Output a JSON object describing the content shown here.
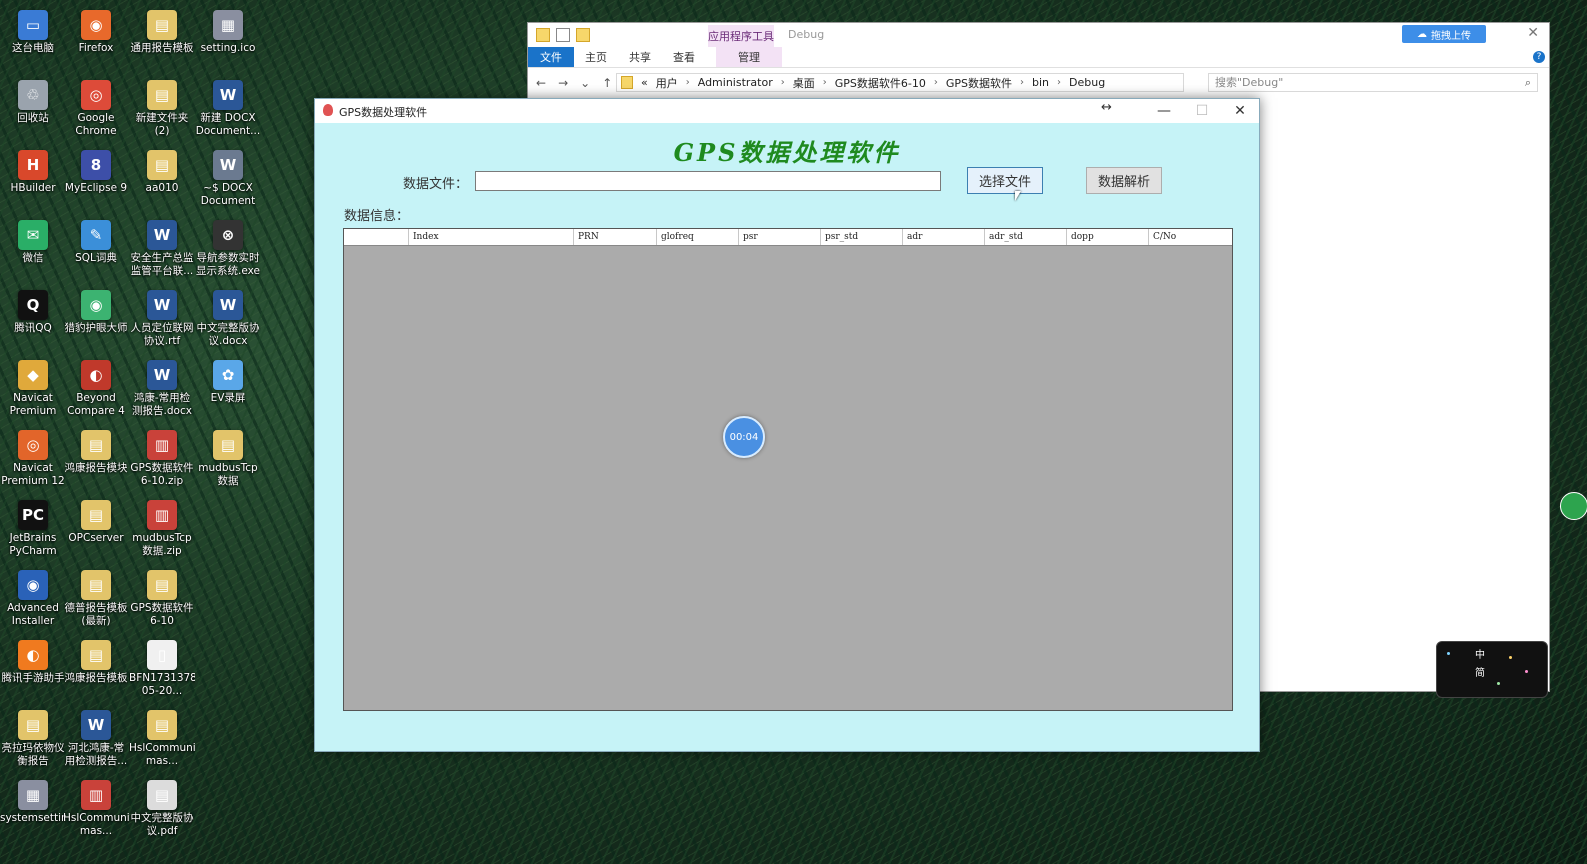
{
  "desktop": {
    "icons": [
      {
        "label": "这台电脑",
        "glyph": "▭",
        "color": "#3a7bd5"
      },
      {
        "label": "Firefox",
        "glyph": "◉",
        "color": "#e8692b"
      },
      {
        "label": "通用报告模板",
        "glyph": "▤",
        "color": "#e2c46a"
      },
      {
        "label": "setting.ico",
        "glyph": "▦",
        "color": "#8a8fa0"
      },
      {
        "label": "回收站",
        "glyph": "♲",
        "color": "#9aa3ad"
      },
      {
        "label": "Google Chrome",
        "glyph": "◎",
        "color": "#dd4b39"
      },
      {
        "label": "新建文件夹 (2)",
        "glyph": "▤",
        "color": "#e2c46a"
      },
      {
        "label": "新建 DOCX Document...",
        "glyph": "W",
        "color": "#2b5797"
      },
      {
        "label": "HBuilder",
        "glyph": "H",
        "color": "#d9482b"
      },
      {
        "label": "MyEclipse 9",
        "glyph": "8",
        "color": "#3d4fa8"
      },
      {
        "label": "aa010",
        "glyph": "▤",
        "color": "#e2c46a"
      },
      {
        "label": "~$ DOCX Document (2...",
        "glyph": "W",
        "color": "#6b7a90"
      },
      {
        "label": "微信",
        "glyph": "✉",
        "color": "#2aae67"
      },
      {
        "label": "SQL词典",
        "glyph": "✎",
        "color": "#3b8fd9"
      },
      {
        "label": "安全生产总监 监管平台联...",
        "glyph": "W",
        "color": "#2b5797"
      },
      {
        "label": "导航参数实时 显示系统.exe",
        "glyph": "⊗",
        "color": "#333333"
      },
      {
        "label": "腾讯QQ",
        "glyph": "Q",
        "color": "#111111"
      },
      {
        "label": "猎豹护眼大师",
        "glyph": "◉",
        "color": "#3cb371"
      },
      {
        "label": "人员定位联网 协议.rtf",
        "glyph": "W",
        "color": "#2b5797"
      },
      {
        "label": "中文完整版协 议.docx",
        "glyph": "W",
        "color": "#2b5797"
      },
      {
        "label": "Navicat Premium",
        "glyph": "◆",
        "color": "#e0a93b"
      },
      {
        "label": "Beyond Compare 4",
        "glyph": "◐",
        "color": "#c0392b"
      },
      {
        "label": "鸿康-常用检 测报告.docx",
        "glyph": "W",
        "color": "#2b5797"
      },
      {
        "label": "EV录屏",
        "glyph": "✿",
        "color": "#5aa7e8"
      },
      {
        "label": "Navicat Premium 12",
        "glyph": "◎",
        "color": "#e2652a"
      },
      {
        "label": "鸿康报告模块",
        "glyph": "▤",
        "color": "#e2c46a"
      },
      {
        "label": "GPS数据软件 6-10.zip",
        "glyph": "▥",
        "color": "#c9423a"
      },
      {
        "label": "mudbusTcp 数据",
        "glyph": "▤",
        "color": "#e2c46a"
      },
      {
        "label": "JetBrains PyCharm Co...",
        "glyph": "PC",
        "color": "#111111"
      },
      {
        "label": "OPCserver",
        "glyph": "▤",
        "color": "#e2c46a"
      },
      {
        "label": "mudbusTcp 数据.zip",
        "glyph": "▥",
        "color": "#c9423a"
      },
      {
        "label": "",
        "glyph": "",
        "color": "transparent"
      },
      {
        "label": "Advanced Installer 15.3",
        "glyph": "◉",
        "color": "#2a62b8"
      },
      {
        "label": "德普报告模板 (最新)",
        "glyph": "▤",
        "color": "#e2c46a"
      },
      {
        "label": "GPS数据软件 6-10",
        "glyph": "▤",
        "color": "#e2c46a"
      },
      {
        "label": "",
        "glyph": "",
        "color": "transparent"
      },
      {
        "label": "腾讯手游助手",
        "glyph": "◐",
        "color": "#f07a1f"
      },
      {
        "label": "鸿康报告模板",
        "glyph": "▤",
        "color": "#e2c46a"
      },
      {
        "label": "BFN17313785_11-05-20...",
        "glyph": "▯",
        "color": "#f0f0f0"
      },
      {
        "label": "",
        "glyph": "",
        "color": "transparent"
      },
      {
        "label": "亮拉玛依物仪 衡报告",
        "glyph": "▤",
        "color": "#e2c46a"
      },
      {
        "label": "河北鸿康-常 用检测报告...",
        "glyph": "W",
        "color": "#2b5797"
      },
      {
        "label": "HslCommunication-mas...",
        "glyph": "▤",
        "color": "#e2c46a"
      },
      {
        "label": "",
        "glyph": "",
        "color": "transparent"
      },
      {
        "label": "systemsetting.png",
        "glyph": "▦",
        "color": "#8a8fa0"
      },
      {
        "label": "HslCommunication-mas...",
        "glyph": "▥",
        "color": "#c9423a"
      },
      {
        "label": "中文完整版协 议.pdf",
        "glyph": "▤",
        "color": "#dcdcdc"
      },
      {
        "label": "",
        "glyph": "",
        "color": "transparent"
      }
    ]
  },
  "explorer": {
    "tool_tab": "应用程序工具",
    "title": "Debug",
    "ribbon_tabs": [
      "文件",
      "主页",
      "共享",
      "查看"
    ],
    "manage_tab": "管理",
    "cloud_button": "拖拽上传",
    "breadcrumbs": [
      "«",
      "用户",
      "Administrator",
      "桌面",
      "GPS数据软件6-10",
      "GPS数据软件",
      "bin",
      "Debug"
    ],
    "search_placeholder": "搜索\"Debug\""
  },
  "app": {
    "title": "GPS数据处理软件",
    "heading": "GPS数据处理软件",
    "file_label": "数据文件：",
    "file_value": "",
    "select_button": "选择文件",
    "parse_button": "数据解析",
    "info_label": "数据信息：",
    "columns": [
      "",
      "Index",
      "PRN",
      "glofreq",
      "psr",
      "psr_std",
      "adr",
      "adr_std",
      "dopp",
      "C/No"
    ],
    "timer": "00:04"
  },
  "ime": {
    "line1": "中",
    "line2": "简"
  }
}
